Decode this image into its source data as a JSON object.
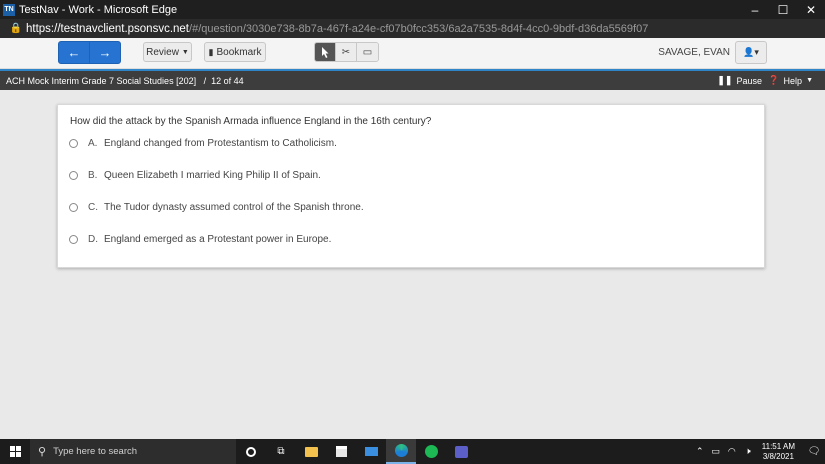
{
  "window": {
    "app_icon_text": "TN",
    "title": "TestNav - Work - Microsoft Edge",
    "minimize": "–",
    "maximize": "☐",
    "close": "✕"
  },
  "address": {
    "host": "https://testnavclient.psonsvc.net",
    "path": "/#/question/3030e738-8b7a-467f-a24e-cf07b0fcc353/6a2a7535-8d4f-4cc0-9bdf-d36da5569f07"
  },
  "toolbar": {
    "back_icon": "←",
    "next_icon": "→",
    "review_label": "Review",
    "bookmark_label": "Bookmark",
    "user_name": "SAVAGE, EVAN"
  },
  "testbar": {
    "test_name": "ACH Mock Interim Grade 7 Social Studies [202]   /  12 of 44",
    "pause_label": "Pause",
    "help_label": "Help"
  },
  "question": {
    "text": "How did the attack by the Spanish Armada influence England in the 16th century?",
    "options": [
      {
        "letter": "A.",
        "text": "England changed from Protestantism to Catholicism."
      },
      {
        "letter": "B.",
        "text": "Queen Elizabeth I married King Philip II of Spain."
      },
      {
        "letter": "C.",
        "text": "The Tudor dynasty assumed control of the Spanish throne."
      },
      {
        "letter": "D.",
        "text": "England emerged as a Protestant power in Europe."
      }
    ]
  },
  "taskbar": {
    "search_placeholder": "Type here to search",
    "time": "11:51 AM",
    "date": "3/8/2021"
  },
  "colors": {
    "accent": "#2673d1",
    "testbar_bg": "#3d3d3d",
    "testbar_border": "#2e86c9"
  }
}
